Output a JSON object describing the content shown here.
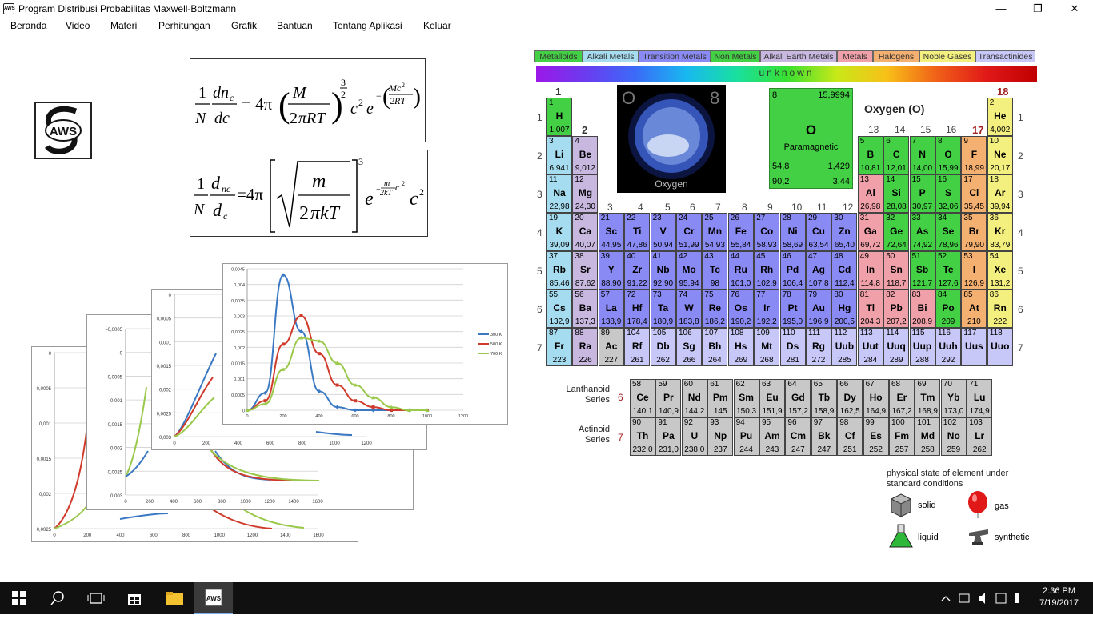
{
  "window": {
    "title": "Program Distribusi Probabilitas Maxwell-Boltzmann",
    "icon_text": "AWS"
  },
  "window_controls": {
    "minimize": "—",
    "maximize": "❐",
    "close": "✕"
  },
  "menu": [
    "Beranda",
    "Video",
    "Materi",
    "Perhitungan",
    "Grafik",
    "Bantuan",
    "Tentang Aplikasi",
    "Keluar"
  ],
  "logo": {
    "text": "AWS"
  },
  "chart_data": [
    {
      "type": "line",
      "title": "",
      "series": [
        {
          "name": "300 K"
        },
        {
          "name": "500 K"
        },
        {
          "name": "700 K"
        }
      ],
      "x": [
        0,
        100,
        200,
        300,
        400,
        500,
        600,
        700,
        800,
        900,
        1000
      ],
      "values": {
        "300 K": [
          0,
          0.00055,
          0.0043,
          0.0025,
          0.0006,
          0.0001,
          0,
          0,
          0,
          0,
          0
        ],
        "500 K": [
          0,
          0.0003,
          0.0021,
          0.003,
          0.0018,
          0.0008,
          0.0003,
          0.0001,
          0,
          0,
          0
        ],
        "700 K": [
          0,
          0.0002,
          0.0013,
          0.0023,
          0.0022,
          0.0015,
          0.0008,
          0.0004,
          0.0001,
          0,
          0
        ]
      },
      "yticks": [
        "0",
        "0,0005",
        "0,001",
        "0,0015",
        "0,002",
        "0,0025",
        "0,003",
        "0,0035",
        "0,004",
        "0,0045"
      ],
      "xticks": [
        "0",
        "200",
        "400",
        "600",
        "800",
        "1000",
        "1200"
      ],
      "legend": [
        "300 K",
        "500 K",
        "700 K"
      ]
    }
  ],
  "chart_ticks": {
    "c1y": [
      "0,0025",
      "0,002",
      "0,0015",
      "0,001",
      "0,0005",
      "0"
    ],
    "c1x": [
      "0",
      "200",
      "400",
      "600",
      "800",
      "1000",
      "1200",
      "1400",
      "1600"
    ],
    "c2y": [
      "0,003",
      "0,0025",
      "0,002",
      "0,0015",
      "0,001",
      "0,0005",
      "0",
      "-0,0005"
    ],
    "c2x": [
      "0",
      "200",
      "400",
      "600",
      "800",
      "1000",
      "1200",
      "1400",
      "1600"
    ],
    "c3y": [
      "0,003",
      "0,0025",
      "0,002",
      "0,0015",
      "0,001",
      "0,0005",
      "0"
    ],
    "c3x": [
      "0",
      "200",
      "400",
      "600",
      "800",
      "1000",
      "1200"
    ]
  },
  "legend_categories": [
    {
      "label": "Metalloids",
      "color": "#44d044",
      "w": 60
    },
    {
      "label": "Alkali Metals",
      "color": "#a6dcf0",
      "w": 70
    },
    {
      "label": "Transition Metals",
      "color": "#8a8af4",
      "w": 90
    },
    {
      "label": "Non Metals",
      "color": "#44d044",
      "w": 62
    },
    {
      "label": "Alkali Earth Metals",
      "color": "#c8b8e0",
      "w": 96
    },
    {
      "label": "Metals",
      "color": "#f0a0a8",
      "w": 45
    },
    {
      "label": "Halogens",
      "color": "#f4b070",
      "w": 58
    },
    {
      "label": "Noble Gases",
      "color": "#f4f080",
      "w": 70
    },
    {
      "label": "Transactinides",
      "color": "#c8c8f8",
      "w": 75
    }
  ],
  "state_bar": "unknown",
  "selected": {
    "name": "Oxygen (O)",
    "symbol": "O",
    "number": "8",
    "mass": "15,9994",
    "state": "Paramagnetic",
    "v1": "54,8",
    "v2": "1,429",
    "v3": "90,2",
    "v4": "3,44",
    "big_number": "8",
    "image_caption": "Oxygen",
    "image_symbol": "O"
  },
  "groups": [
    "1",
    "2",
    "3",
    "4",
    "5",
    "6",
    "7",
    "8",
    "9",
    "10",
    "11",
    "12",
    "13",
    "14",
    "15",
    "16",
    "17",
    "18"
  ],
  "periods": [
    "1",
    "2",
    "3",
    "4",
    "5",
    "6",
    "7"
  ],
  "series_labels": {
    "lanthanoid": "Lanthanoid Series",
    "lanthanoid_num": "6",
    "actinoid": "Actinoid Series",
    "actinoid_num": "7"
  },
  "elements": [
    [
      "1",
      "H",
      "1,007",
      1,
      1,
      "#44d044"
    ],
    [
      "2",
      "He",
      "4,002",
      18,
      1,
      "#f4f080"
    ],
    [
      "3",
      "Li",
      "6,941",
      1,
      2,
      "#a6dcf0"
    ],
    [
      "4",
      "Be",
      "9,012",
      2,
      2,
      "#c8b8e0"
    ],
    [
      "5",
      "B",
      "10,81",
      13,
      2,
      "#44d044"
    ],
    [
      "6",
      "C",
      "12,01",
      14,
      2,
      "#44d044"
    ],
    [
      "7",
      "N",
      "14,00",
      15,
      2,
      "#44d044"
    ],
    [
      "8",
      "O",
      "15,99",
      16,
      2,
      "#44d044"
    ],
    [
      "9",
      "F",
      "18,99",
      17,
      2,
      "#f4b070"
    ],
    [
      "10",
      "Ne",
      "20,17",
      18,
      2,
      "#f4f080"
    ],
    [
      "11",
      "Na",
      "22,98",
      1,
      3,
      "#a6dcf0"
    ],
    [
      "12",
      "Mg",
      "24,30",
      2,
      3,
      "#c8b8e0"
    ],
    [
      "13",
      "Al",
      "26,98",
      13,
      3,
      "#f0a0a8"
    ],
    [
      "14",
      "Si",
      "28,08",
      14,
      3,
      "#44d044"
    ],
    [
      "15",
      "P",
      "30,97",
      15,
      3,
      "#44d044"
    ],
    [
      "16",
      "S",
      "32,06",
      16,
      3,
      "#44d044"
    ],
    [
      "17",
      "Cl",
      "35,45",
      17,
      3,
      "#f4b070"
    ],
    [
      "18",
      "Ar",
      "39,94",
      18,
      3,
      "#f4f080"
    ],
    [
      "19",
      "K",
      "39,09",
      1,
      4,
      "#a6dcf0"
    ],
    [
      "20",
      "Ca",
      "40,07",
      2,
      4,
      "#c8b8e0"
    ],
    [
      "21",
      "Sc",
      "44,95",
      3,
      4,
      "#8a8af4"
    ],
    [
      "22",
      "Ti",
      "47,86",
      4,
      4,
      "#8a8af4"
    ],
    [
      "23",
      "V",
      "50,94",
      5,
      4,
      "#8a8af4"
    ],
    [
      "24",
      "Cr",
      "51,99",
      6,
      4,
      "#8a8af4"
    ],
    [
      "25",
      "Mn",
      "54,93",
      7,
      4,
      "#8a8af4"
    ],
    [
      "26",
      "Fe",
      "55,84",
      8,
      4,
      "#8a8af4"
    ],
    [
      "27",
      "Co",
      "58,93",
      9,
      4,
      "#8a8af4"
    ],
    [
      "28",
      "Ni",
      "58,69",
      10,
      4,
      "#8a8af4"
    ],
    [
      "29",
      "Cu",
      "63,54",
      11,
      4,
      "#8a8af4"
    ],
    [
      "30",
      "Zn",
      "65,40",
      12,
      4,
      "#8a8af4"
    ],
    [
      "31",
      "Ga",
      "69,72",
      13,
      4,
      "#f0a0a8"
    ],
    [
      "32",
      "Ge",
      "72,64",
      14,
      4,
      "#44d044"
    ],
    [
      "33",
      "As",
      "74,92",
      15,
      4,
      "#44d044"
    ],
    [
      "34",
      "Se",
      "78,96",
      16,
      4,
      "#44d044"
    ],
    [
      "35",
      "Br",
      "79,90",
      17,
      4,
      "#f4b070"
    ],
    [
      "36",
      "Kr",
      "83,79",
      18,
      4,
      "#f4f080"
    ],
    [
      "37",
      "Rb",
      "85,46",
      1,
      5,
      "#a6dcf0"
    ],
    [
      "38",
      "Sr",
      "87,62",
      2,
      5,
      "#c8b8e0"
    ],
    [
      "39",
      "Y",
      "88,90",
      3,
      5,
      "#8a8af4"
    ],
    [
      "40",
      "Zr",
      "91,22",
      4,
      5,
      "#8a8af4"
    ],
    [
      "41",
      "Nb",
      "92,90",
      5,
      5,
      "#8a8af4"
    ],
    [
      "42",
      "Mo",
      "95,94",
      6,
      5,
      "#8a8af4"
    ],
    [
      "43",
      "Tc",
      "98",
      7,
      5,
      "#8a8af4"
    ],
    [
      "44",
      "Ru",
      "101,0",
      8,
      5,
      "#8a8af4"
    ],
    [
      "45",
      "Rh",
      "102,9",
      9,
      5,
      "#8a8af4"
    ],
    [
      "46",
      "Pd",
      "106,4",
      10,
      5,
      "#8a8af4"
    ],
    [
      "47",
      "Ag",
      "107,8",
      11,
      5,
      "#8a8af4"
    ],
    [
      "48",
      "Cd",
      "112,4",
      12,
      5,
      "#8a8af4"
    ],
    [
      "49",
      "In",
      "114,8",
      13,
      5,
      "#f0a0a8"
    ],
    [
      "50",
      "Sn",
      "118,7",
      14,
      5,
      "#f0a0a8"
    ],
    [
      "51",
      "Sb",
      "121,7",
      15,
      5,
      "#44d044"
    ],
    [
      "52",
      "Te",
      "127,6",
      16,
      5,
      "#44d044"
    ],
    [
      "53",
      "I",
      "126,9",
      17,
      5,
      "#f4b070"
    ],
    [
      "54",
      "Xe",
      "131,2",
      18,
      5,
      "#f4f080"
    ],
    [
      "55",
      "Cs",
      "132,9",
      1,
      6,
      "#a6dcf0"
    ],
    [
      "56",
      "Ba",
      "137,3",
      2,
      6,
      "#c8b8e0"
    ],
    [
      "57",
      "La",
      "138,9",
      3,
      6,
      "#8a8af4"
    ],
    [
      "72",
      "Hf",
      "178,4",
      4,
      6,
      "#8a8af4"
    ],
    [
      "73",
      "Ta",
      "180,9",
      5,
      6,
      "#8a8af4"
    ],
    [
      "74",
      "W",
      "183,8",
      6,
      6,
      "#8a8af4"
    ],
    [
      "75",
      "Re",
      "186,2",
      7,
      6,
      "#8a8af4"
    ],
    [
      "76",
      "Os",
      "190,2",
      8,
      6,
      "#8a8af4"
    ],
    [
      "77",
      "Ir",
      "192,2",
      9,
      6,
      "#8a8af4"
    ],
    [
      "78",
      "Pt",
      "195,0",
      10,
      6,
      "#8a8af4"
    ],
    [
      "79",
      "Au",
      "196,9",
      11,
      6,
      "#8a8af4"
    ],
    [
      "80",
      "Hg",
      "200,5",
      12,
      6,
      "#8a8af4"
    ],
    [
      "81",
      "Tl",
      "204,3",
      13,
      6,
      "#f0a0a8"
    ],
    [
      "82",
      "Pb",
      "207,2",
      14,
      6,
      "#f0a0a8"
    ],
    [
      "83",
      "Bi",
      "208,9",
      15,
      6,
      "#f0a0a8"
    ],
    [
      "84",
      "Po",
      "209",
      16,
      6,
      "#44d044"
    ],
    [
      "85",
      "At",
      "210",
      17,
      6,
      "#f4b070"
    ],
    [
      "86",
      "Rn",
      "222",
      18,
      6,
      "#f4f080"
    ],
    [
      "87",
      "Fr",
      "223",
      1,
      7,
      "#a6dcf0"
    ],
    [
      "88",
      "Ra",
      "226",
      2,
      7,
      "#c8b8e0"
    ],
    [
      "89",
      "Ac",
      "227",
      3,
      7,
      "#c8c8c8"
    ],
    [
      "104",
      "Rf",
      "261",
      4,
      7,
      "#c8c8f8"
    ],
    [
      "105",
      "Db",
      "262",
      5,
      7,
      "#c8c8f8"
    ],
    [
      "106",
      "Sg",
      "266",
      6,
      7,
      "#c8c8f8"
    ],
    [
      "107",
      "Bh",
      "264",
      7,
      7,
      "#c8c8f8"
    ],
    [
      "108",
      "Hs",
      "269",
      8,
      7,
      "#c8c8f8"
    ],
    [
      "109",
      "Mt",
      "268",
      9,
      7,
      "#c8c8f8"
    ],
    [
      "110",
      "Ds",
      "281",
      10,
      7,
      "#c8c8f8"
    ],
    [
      "111",
      "Rg",
      "272",
      11,
      7,
      "#c8c8f8"
    ],
    [
      "112",
      "Uub",
      "285",
      12,
      7,
      "#c8c8f8"
    ],
    [
      "113",
      "Uut",
      "284",
      13,
      7,
      "#c8c8f8"
    ],
    [
      "114",
      "Uuq",
      "289",
      14,
      7,
      "#c8c8f8"
    ],
    [
      "115",
      "Uup",
      "288",
      15,
      7,
      "#c8c8f8"
    ],
    [
      "116",
      "Uuh",
      "292",
      16,
      7,
      "#c8c8f8"
    ],
    [
      "117",
      "Uus",
      "",
      17,
      7,
      "#c8c8f8"
    ],
    [
      "118",
      "Uuo",
      "",
      18,
      7,
      "#c8c8f8"
    ]
  ],
  "lanthanides": [
    [
      "58",
      "Ce",
      "140,1"
    ],
    [
      "59",
      "Pr",
      "140,9"
    ],
    [
      "60",
      "Nd",
      "144,2"
    ],
    [
      "61",
      "Pm",
      "145"
    ],
    [
      "62",
      "Sm",
      "150,3"
    ],
    [
      "63",
      "Eu",
      "151,9"
    ],
    [
      "64",
      "Gd",
      "157,2"
    ],
    [
      "65",
      "Tb",
      "158,9"
    ],
    [
      "66",
      "Dy",
      "162,5"
    ],
    [
      "67",
      "Ho",
      "164,9"
    ],
    [
      "68",
      "Er",
      "167,2"
    ],
    [
      "69",
      "Tm",
      "168,9"
    ],
    [
      "70",
      "Yb",
      "173,0"
    ],
    [
      "71",
      "Lu",
      "174,9"
    ]
  ],
  "actinides": [
    [
      "90",
      "Th",
      "232,0"
    ],
    [
      "91",
      "Pa",
      "231,0"
    ],
    [
      "92",
      "U",
      "238,0"
    ],
    [
      "93",
      "Np",
      "237"
    ],
    [
      "94",
      "Pu",
      "244"
    ],
    [
      "95",
      "Am",
      "243"
    ],
    [
      "96",
      "Cm",
      "247"
    ],
    [
      "97",
      "Bk",
      "247"
    ],
    [
      "98",
      "Cf",
      "251"
    ],
    [
      "99",
      "Es",
      "252"
    ],
    [
      "100",
      "Fm",
      "257"
    ],
    [
      "101",
      "Md",
      "258"
    ],
    [
      "102",
      "No",
      "259"
    ],
    [
      "103",
      "Lr",
      "262"
    ]
  ],
  "state_legend": {
    "title": "physical state of element under standard conditions",
    "solid": "solid",
    "gas": "gas",
    "liquid": "liquid",
    "synthetic": "synthetic"
  },
  "taskbar": {
    "time": "2:36 PM",
    "date": "7/19/2017"
  }
}
